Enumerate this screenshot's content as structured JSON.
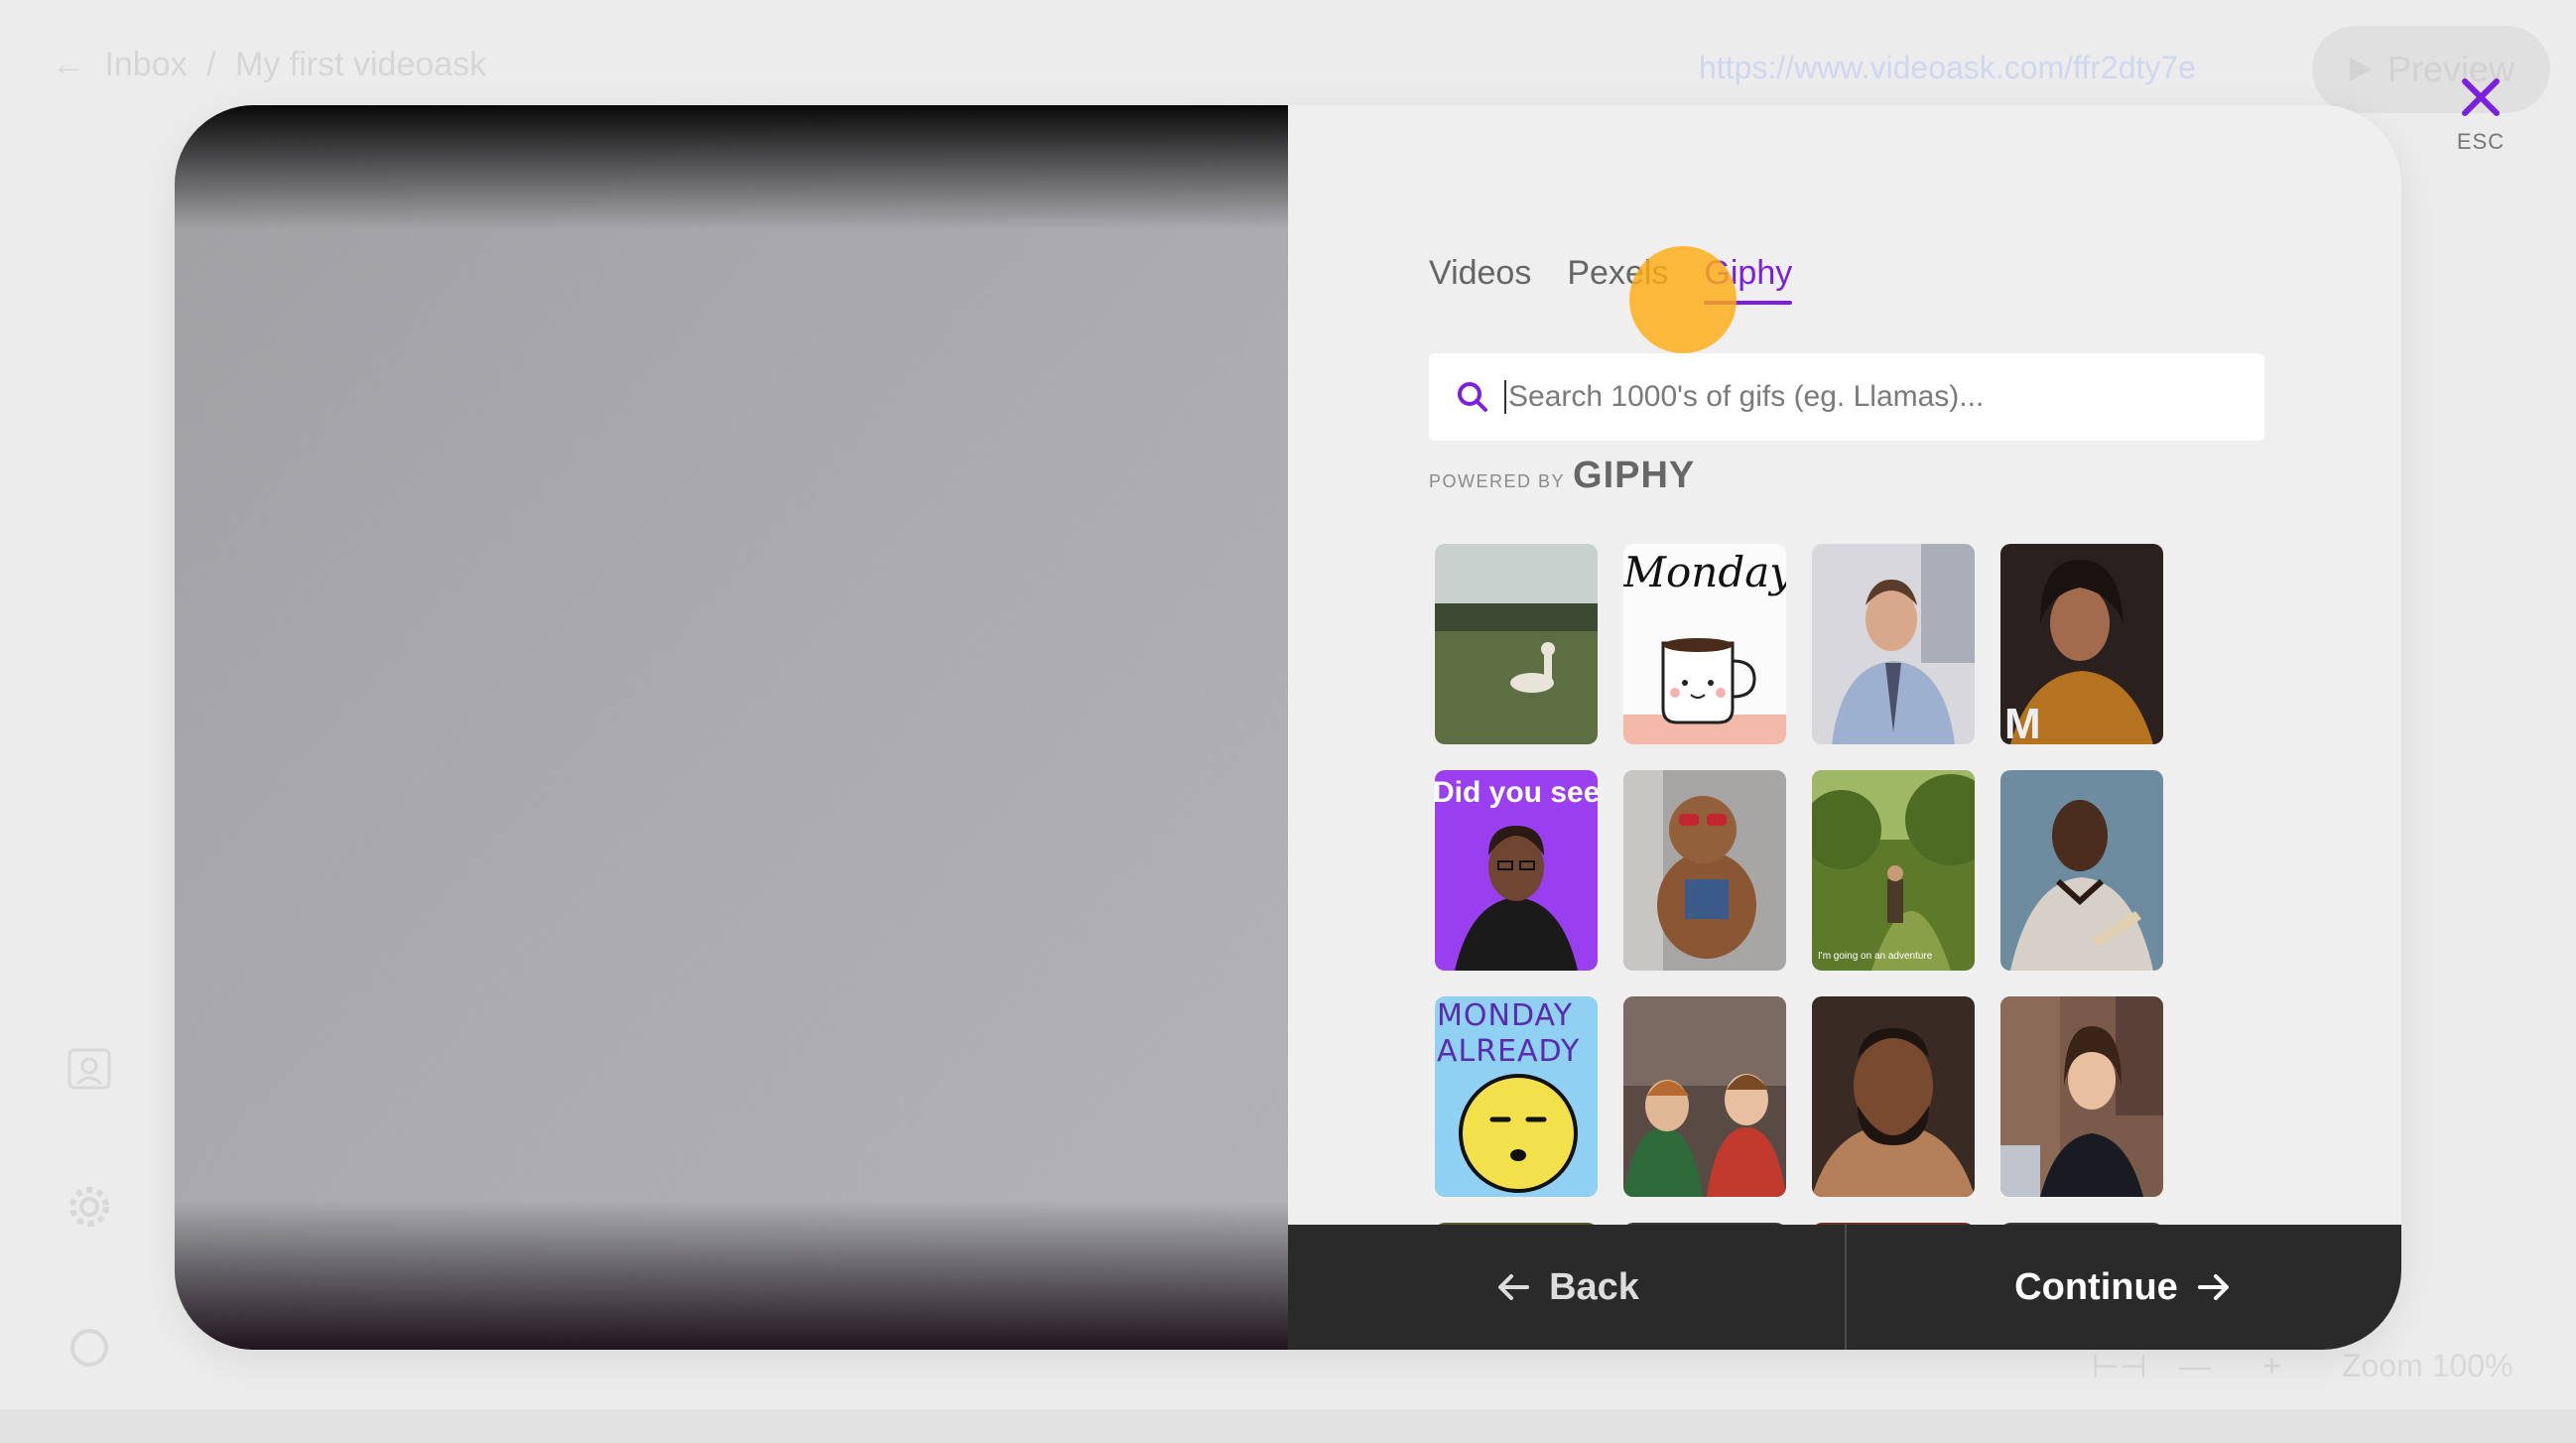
{
  "background": {
    "breadcrumb": [
      "←",
      "Inbox",
      "/",
      "My first videoask"
    ],
    "url": "https://www.videoask.com/ffr2dty7e",
    "preview_label": "Preview",
    "zoom_label": "Zoom 100%"
  },
  "close": {
    "esc_label": "ESC"
  },
  "tabs": [
    {
      "label": "Videos",
      "active": false
    },
    {
      "label": "Pexels",
      "active": false
    },
    {
      "label": "Giphy",
      "active": true
    }
  ],
  "search": {
    "placeholder": "Search 1000's of gifs (eg. Llamas)..."
  },
  "powered_by": {
    "prefix": "POWERED BY",
    "brand": "GIPHY"
  },
  "gifs": [
    {
      "name": "llama-in-field"
    },
    {
      "name": "monday-coffee-mug",
      "caption": "Monday"
    },
    {
      "name": "office-man-tie"
    },
    {
      "name": "woman-fan"
    },
    {
      "name": "did-you-see",
      "caption": "Did you see"
    },
    {
      "name": "dog-sunglasses"
    },
    {
      "name": "adventure-hobbit"
    },
    {
      "name": "man-sweater"
    },
    {
      "name": "monday-already",
      "caption": "MONDAY ALREADY"
    },
    {
      "name": "kids-surprised"
    },
    {
      "name": "bearded-man"
    },
    {
      "name": "woman-smiling"
    }
  ],
  "footer": {
    "back_label": "Back",
    "continue_label": "Continue"
  },
  "colors": {
    "accent": "#7b1fe0",
    "cursor": "#ffac14",
    "footer": "#2a2a2a"
  }
}
